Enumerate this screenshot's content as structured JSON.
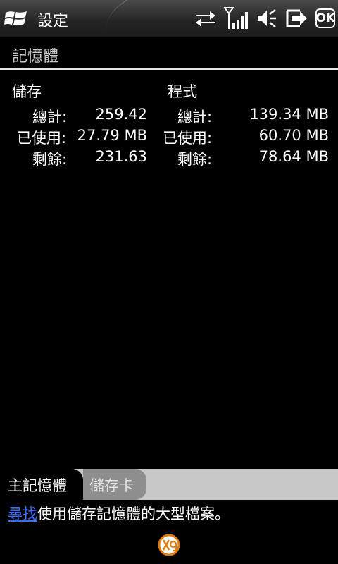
{
  "titlebar": {
    "title": "設定",
    "ok_label": "OK"
  },
  "page": {
    "title": "記憶體"
  },
  "storage": {
    "heading": "儲存",
    "rows": [
      {
        "label": "總計:",
        "value": "259.42"
      },
      {
        "label": "已使用:",
        "value": "27.79 MB"
      },
      {
        "label": "剩餘:",
        "value": "231.63"
      }
    ]
  },
  "program": {
    "heading": "程式",
    "rows": [
      {
        "label": "總計:",
        "value": "139.34 MB"
      },
      {
        "label": "已使用:",
        "value": "60.70 MB"
      },
      {
        "label": "剩餘:",
        "value": "78.64 MB"
      }
    ]
  },
  "tabs": [
    {
      "label": "主記憶體",
      "active": true
    },
    {
      "label": "儲存卡",
      "active": false
    }
  ],
  "hint": {
    "link": "尋找",
    "text": "使用儲存記憶體的大型檔案。"
  },
  "icons": [
    "windows-start-icon",
    "data-sync-icon",
    "signal-icon",
    "volume-mute-icon",
    "connection-icon",
    "app-logo-icon"
  ]
}
